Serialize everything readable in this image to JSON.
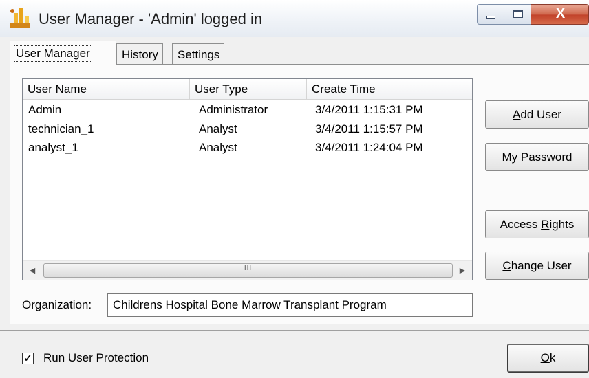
{
  "window": {
    "title": "User Manager - 'Admin' logged in",
    "icon": "user-manager-app-icon",
    "close_glyph": "X"
  },
  "tabs": [
    {
      "label": "User Manager",
      "selected": true
    },
    {
      "label": "History",
      "selected": false
    },
    {
      "label": "Settings",
      "selected": false
    }
  ],
  "user_list": {
    "columns": [
      "User Name",
      "User Type",
      "Create Time"
    ],
    "rows": [
      [
        "Admin",
        "Administrator",
        "3/4/2011 1:15:31 PM"
      ],
      [
        "technician_1",
        "Analyst",
        "3/4/2011 1:15:57 PM"
      ],
      [
        "analyst_1",
        "Analyst",
        "3/4/2011 1:24:04 PM"
      ]
    ],
    "scroll_grip": "III"
  },
  "buttons": {
    "add_user": {
      "before": "",
      "mnemonic": "A",
      "after": "dd User"
    },
    "my_password": {
      "before": "My ",
      "mnemonic": "P",
      "after": "assword"
    },
    "access_rights": {
      "before": "Access ",
      "mnemonic": "R",
      "after": "ights"
    },
    "change_user": {
      "before": "",
      "mnemonic": "C",
      "after": "hange User"
    },
    "ok": {
      "before": "",
      "mnemonic": "O",
      "after": "k"
    }
  },
  "organization": {
    "label": "Organization:",
    "value": "Childrens Hospital Bone Marrow Transplant Program"
  },
  "run_user_protection": {
    "label": "Run User Protection",
    "checked": true,
    "check_glyph": "✓"
  },
  "colors": {
    "close_button": "#c2432a",
    "titlebar": "#eef2f7"
  }
}
